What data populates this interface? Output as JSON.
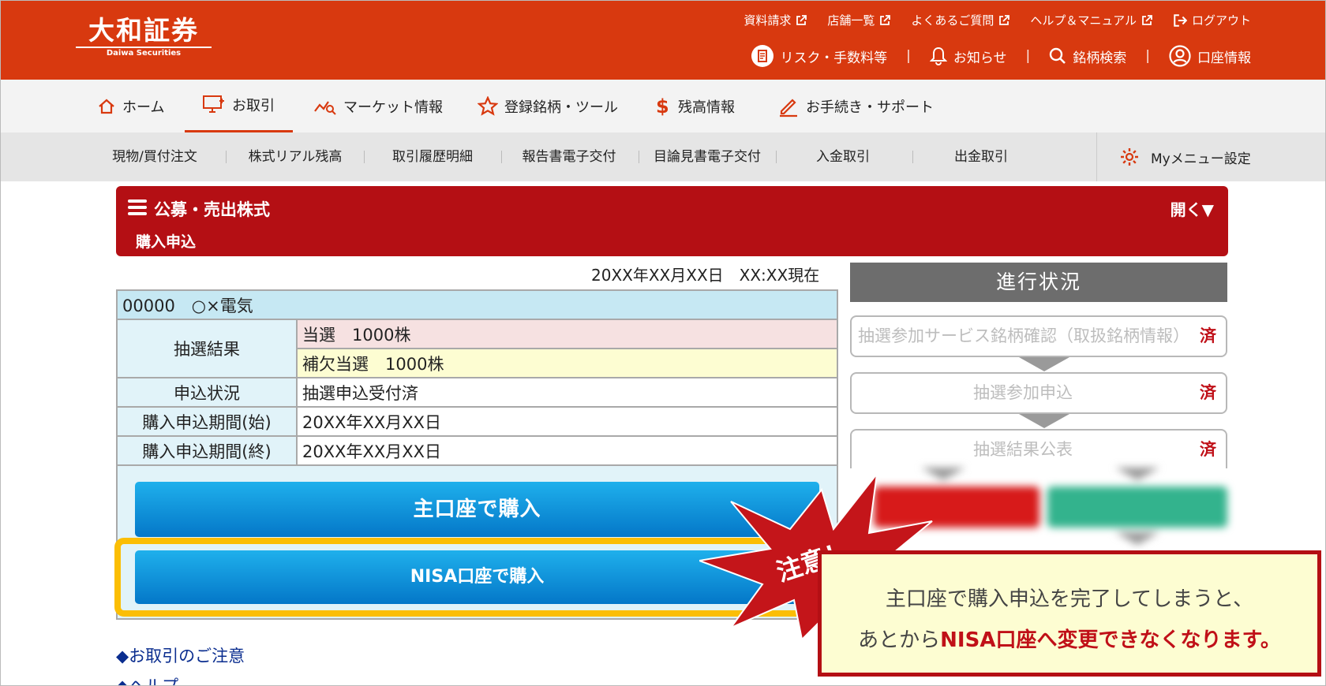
{
  "header": {
    "logo_jp": "大和証券",
    "logo_en": "Daiwa Securities",
    "util_links": [
      {
        "label": "資料請求",
        "icon": "external-link-icon"
      },
      {
        "label": "店舗一覧",
        "icon": "external-link-icon"
      },
      {
        "label": "よくあるご質問",
        "icon": "external-link-icon"
      },
      {
        "label": "ヘルプ＆マニュアル",
        "icon": "external-link-icon"
      },
      {
        "label": "ログアウト",
        "icon": "logout-icon"
      }
    ],
    "util_links2": [
      {
        "label": "リスク・手数料等",
        "icon": "document-icon"
      },
      {
        "label": "お知らせ",
        "icon": "bell-icon"
      },
      {
        "label": "銘柄検索",
        "icon": "search-icon"
      },
      {
        "label": "口座情報",
        "icon": "user-icon"
      }
    ]
  },
  "main_nav": [
    {
      "label": "ホーム",
      "icon": "home-icon"
    },
    {
      "label": "お取引",
      "icon": "trade-icon",
      "active": true
    },
    {
      "label": "マーケット情報",
      "icon": "market-icon"
    },
    {
      "label": "登録銘柄・ツール",
      "icon": "star-icon"
    },
    {
      "label": "残高情報",
      "icon": "dollar-icon"
    },
    {
      "label": "お手続き・サポート",
      "icon": "pencil-icon"
    }
  ],
  "sub_nav": [
    "現物/買付注文",
    "株式リアル残高",
    "取引履歴明細",
    "報告書電子交付",
    "目論見書電子交付",
    "入金取引",
    "出金取引"
  ],
  "my_menu": "Myメニュー設定",
  "section": {
    "title": "公募・売出株式",
    "subtitle": "購入申込",
    "toggle": "開く▼"
  },
  "timestamp": "20XX年XX月XX日　XX:XX現在",
  "stock": {
    "name": "00000　○×電気",
    "lottery_label": "抽選結果",
    "lottery_win": "当選　1000株",
    "lottery_sub": "補欠当選　1000株",
    "status_label": "申込状況",
    "status_value": "抽選申込受付済",
    "start_label": "購入申込期間(始)",
    "start_value": "20XX年XX月XX日",
    "end_label": "購入申込期間(終)",
    "end_value": "20XX年XX月XX日"
  },
  "buttons": {
    "main_account": "主口座で購入",
    "nisa_account": "NISA口座で購入"
  },
  "links": [
    "◆お取引のご注意",
    "◆ヘルプ"
  ],
  "progress": {
    "title": "進行状況",
    "steps": [
      {
        "label": "抽選参加サービス銘柄確認（取扱銘柄情報）",
        "done": "済"
      },
      {
        "label": "抽選参加申込",
        "done": "済"
      },
      {
        "label": "抽選結果公表",
        "done": "済"
      }
    ]
  },
  "caution": {
    "burst": "注意！",
    "line1": "主口座で購入申込を完了してしまうと、",
    "line2_pre": "あとから",
    "line2_em": "NISA口座へ変更できなくなります",
    "line2_post": "。"
  },
  "colors": {
    "brand_orange": "#d8390f",
    "section_red": "#b40f14",
    "button_blue": "#0a8fd8",
    "highlight_yellow": "#fbbe05"
  }
}
